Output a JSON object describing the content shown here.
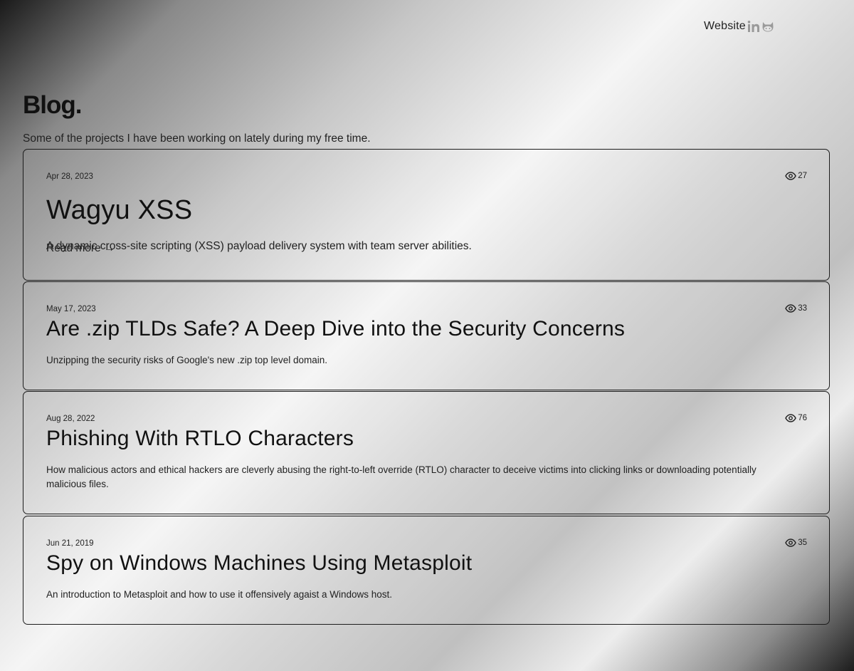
{
  "nav": {
    "website_label": "Website",
    "linkedin_icon": "linkedin-icon",
    "github_icon": "github-icon"
  },
  "header": {
    "title": "Blog.",
    "subtitle": "Some of the projects I have been working on lately during my free time."
  },
  "posts": [
    {
      "date": "Apr 28, 2023",
      "views": "27",
      "title": "Wagyu XSS",
      "description": "A dynamic cross-site scripting (XSS) payload delivery system with team server abilities.",
      "read_more": "Read more →"
    },
    {
      "date": "May 17, 2023",
      "views": "33",
      "title": "Are .zip TLDs Safe? A Deep Dive into the Security Concerns",
      "description": "Unzipping the security risks of Google's new .zip top level domain."
    },
    {
      "date": "Aug 28, 2022",
      "views": "76",
      "title": "Phishing With RTLO Characters",
      "description": "How malicious actors and ethical hackers are cleverly abusing the right-to-left override (RTLO) character to deceive victims into clicking links or downloading potentially malicious files."
    },
    {
      "date": "Jun 21, 2019",
      "views": "35",
      "title": "Spy on Windows Machines Using Metasploit",
      "description": "An introduction to Metasploit and how to use it offensively agaist a Windows host."
    }
  ],
  "icons": {
    "views": "eye-icon"
  }
}
